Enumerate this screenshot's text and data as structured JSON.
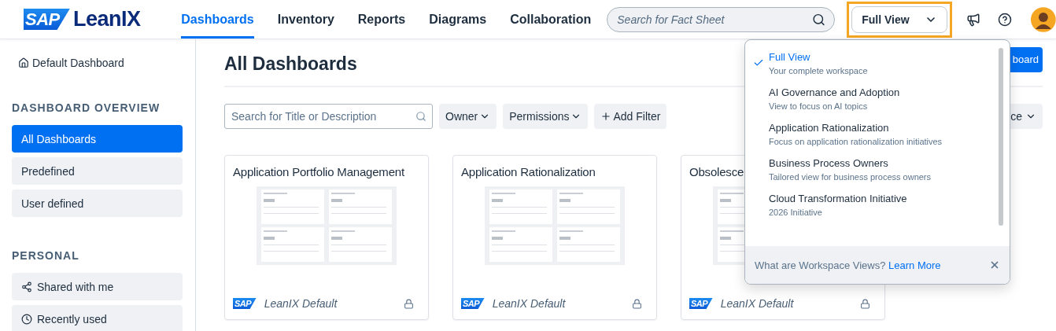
{
  "header": {
    "logo": {
      "brand": "SAP",
      "product": "LeanIX"
    },
    "nav": [
      {
        "label": "Dashboards",
        "selected": true
      },
      {
        "label": "Inventory",
        "selected": false
      },
      {
        "label": "Reports",
        "selected": false
      },
      {
        "label": "Diagrams",
        "selected": false
      },
      {
        "label": "Collaboration",
        "selected": false
      }
    ],
    "search": {
      "placeholder": "Search for Fact Sheet"
    },
    "view_select": {
      "value": "Full View",
      "focused": true
    }
  },
  "sidebar": {
    "default_link": "Default Dashboard",
    "sections": [
      {
        "title": "DASHBOARD OVERVIEW",
        "items": [
          {
            "label": "All Dashboards",
            "selected": true,
            "kind": "plain"
          },
          {
            "label": "Predefined",
            "selected": false,
            "kind": "plain"
          },
          {
            "label": "User defined",
            "selected": false,
            "kind": "plain"
          }
        ]
      },
      {
        "title": "PERSONAL",
        "items": [
          {
            "label": "Shared with me",
            "selected": false,
            "kind": "shared"
          },
          {
            "label": "Recently used",
            "selected": false,
            "kind": "recent"
          }
        ]
      }
    ]
  },
  "main": {
    "title": "All Dashboards",
    "create_button": "board",
    "search": {
      "placeholder": "Search for Title or Description"
    },
    "filters": [
      {
        "label": "Owner",
        "kind": "dropdown"
      },
      {
        "label": "Permissions",
        "kind": "dropdown"
      },
      {
        "label": "Add Filter",
        "kind": "add"
      }
    ],
    "sort": "ce",
    "cards": [
      {
        "title": "Application Portfolio Management",
        "owner_logo": "SAP",
        "owner": "LeanIX Default",
        "locked": true
      },
      {
        "title": "Application Rationalization",
        "owner_logo": "SAP",
        "owner": "LeanIX Default",
        "locked": true
      },
      {
        "title": "Obsolesce",
        "owner_logo": "SAP",
        "owner": "LeanIX Default",
        "locked": true
      }
    ]
  },
  "popover": {
    "items": [
      {
        "title": "Full View",
        "description": "Your complete workspace",
        "selected": true
      },
      {
        "title": "AI Governance and Adoption",
        "description": "View to focus on AI topics",
        "selected": false
      },
      {
        "title": "Application Rationalization",
        "description": "Focus on application rationalization initiatives",
        "selected": false
      },
      {
        "title": "Business Process Owners",
        "description": "Tailored view for business process owners",
        "selected": false
      },
      {
        "title": "Cloud Transformation Initiative",
        "description": "2026 Initiative",
        "selected": false
      }
    ],
    "footer": {
      "text": "What are Workspace Views?",
      "link": "Learn More"
    }
  }
}
